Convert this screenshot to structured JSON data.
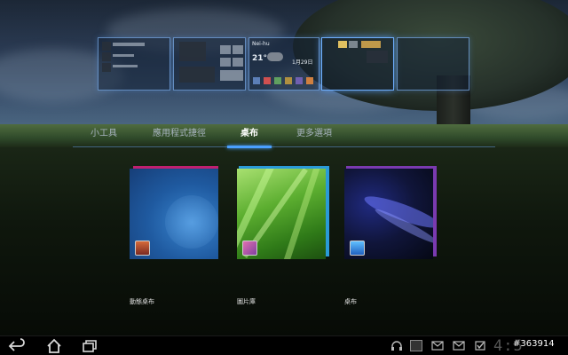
{
  "tabs": [
    {
      "label": "小工具",
      "selected": false
    },
    {
      "label": "應用程式捷徑",
      "selected": false
    },
    {
      "label": "桌布",
      "selected": true
    },
    {
      "label": "更多選項",
      "selected": false
    }
  ],
  "home_previews": {
    "widget_weather_city": "Nei-hu",
    "widget_weather_temp": "21°",
    "widget_date": "1月29日"
  },
  "wallpaper_choices": [
    {
      "label": "動態桌布",
      "icon": "live-wallpaper-icon"
    },
    {
      "label": "圖片庫",
      "icon": "gallery-icon"
    },
    {
      "label": "桌布",
      "icon": "wallpapers-icon"
    }
  ],
  "navbar": {
    "back_icon": "back-arrow-icon",
    "home_icon": "home-icon",
    "recent_icon": "recent-apps-icon",
    "clock": "4:5",
    "watermark": "#363914"
  },
  "colors": {
    "accent": "#4aa0ff",
    "tab_text": "#a8b4c0"
  }
}
